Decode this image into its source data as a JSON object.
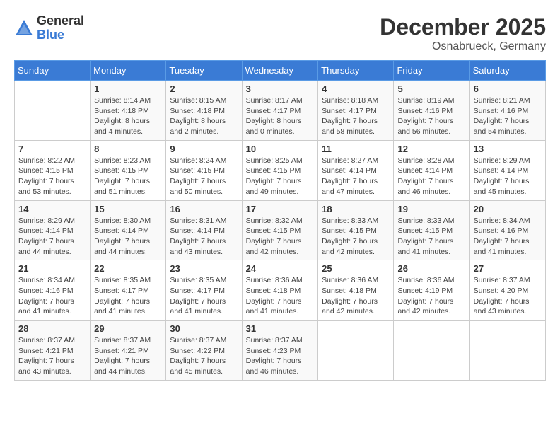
{
  "header": {
    "logo_general": "General",
    "logo_blue": "Blue",
    "month": "December 2025",
    "location": "Osnabrueck, Germany"
  },
  "days_of_week": [
    "Sunday",
    "Monday",
    "Tuesday",
    "Wednesday",
    "Thursday",
    "Friday",
    "Saturday"
  ],
  "weeks": [
    [
      {
        "day": "",
        "info": ""
      },
      {
        "day": "1",
        "info": "Sunrise: 8:14 AM\nSunset: 4:18 PM\nDaylight: 8 hours\nand 4 minutes."
      },
      {
        "day": "2",
        "info": "Sunrise: 8:15 AM\nSunset: 4:18 PM\nDaylight: 8 hours\nand 2 minutes."
      },
      {
        "day": "3",
        "info": "Sunrise: 8:17 AM\nSunset: 4:17 PM\nDaylight: 8 hours\nand 0 minutes."
      },
      {
        "day": "4",
        "info": "Sunrise: 8:18 AM\nSunset: 4:17 PM\nDaylight: 7 hours\nand 58 minutes."
      },
      {
        "day": "5",
        "info": "Sunrise: 8:19 AM\nSunset: 4:16 PM\nDaylight: 7 hours\nand 56 minutes."
      },
      {
        "day": "6",
        "info": "Sunrise: 8:21 AM\nSunset: 4:16 PM\nDaylight: 7 hours\nand 54 minutes."
      }
    ],
    [
      {
        "day": "7",
        "info": "Sunrise: 8:22 AM\nSunset: 4:15 PM\nDaylight: 7 hours\nand 53 minutes."
      },
      {
        "day": "8",
        "info": "Sunrise: 8:23 AM\nSunset: 4:15 PM\nDaylight: 7 hours\nand 51 minutes."
      },
      {
        "day": "9",
        "info": "Sunrise: 8:24 AM\nSunset: 4:15 PM\nDaylight: 7 hours\nand 50 minutes."
      },
      {
        "day": "10",
        "info": "Sunrise: 8:25 AM\nSunset: 4:15 PM\nDaylight: 7 hours\nand 49 minutes."
      },
      {
        "day": "11",
        "info": "Sunrise: 8:27 AM\nSunset: 4:14 PM\nDaylight: 7 hours\nand 47 minutes."
      },
      {
        "day": "12",
        "info": "Sunrise: 8:28 AM\nSunset: 4:14 PM\nDaylight: 7 hours\nand 46 minutes."
      },
      {
        "day": "13",
        "info": "Sunrise: 8:29 AM\nSunset: 4:14 PM\nDaylight: 7 hours\nand 45 minutes."
      }
    ],
    [
      {
        "day": "14",
        "info": "Sunrise: 8:29 AM\nSunset: 4:14 PM\nDaylight: 7 hours\nand 44 minutes."
      },
      {
        "day": "15",
        "info": "Sunrise: 8:30 AM\nSunset: 4:14 PM\nDaylight: 7 hours\nand 44 minutes."
      },
      {
        "day": "16",
        "info": "Sunrise: 8:31 AM\nSunset: 4:14 PM\nDaylight: 7 hours\nand 43 minutes."
      },
      {
        "day": "17",
        "info": "Sunrise: 8:32 AM\nSunset: 4:15 PM\nDaylight: 7 hours\nand 42 minutes."
      },
      {
        "day": "18",
        "info": "Sunrise: 8:33 AM\nSunset: 4:15 PM\nDaylight: 7 hours\nand 42 minutes."
      },
      {
        "day": "19",
        "info": "Sunrise: 8:33 AM\nSunset: 4:15 PM\nDaylight: 7 hours\nand 41 minutes."
      },
      {
        "day": "20",
        "info": "Sunrise: 8:34 AM\nSunset: 4:16 PM\nDaylight: 7 hours\nand 41 minutes."
      }
    ],
    [
      {
        "day": "21",
        "info": "Sunrise: 8:34 AM\nSunset: 4:16 PM\nDaylight: 7 hours\nand 41 minutes."
      },
      {
        "day": "22",
        "info": "Sunrise: 8:35 AM\nSunset: 4:17 PM\nDaylight: 7 hours\nand 41 minutes."
      },
      {
        "day": "23",
        "info": "Sunrise: 8:35 AM\nSunset: 4:17 PM\nDaylight: 7 hours\nand 41 minutes."
      },
      {
        "day": "24",
        "info": "Sunrise: 8:36 AM\nSunset: 4:18 PM\nDaylight: 7 hours\nand 41 minutes."
      },
      {
        "day": "25",
        "info": "Sunrise: 8:36 AM\nSunset: 4:18 PM\nDaylight: 7 hours\nand 42 minutes."
      },
      {
        "day": "26",
        "info": "Sunrise: 8:36 AM\nSunset: 4:19 PM\nDaylight: 7 hours\nand 42 minutes."
      },
      {
        "day": "27",
        "info": "Sunrise: 8:37 AM\nSunset: 4:20 PM\nDaylight: 7 hours\nand 43 minutes."
      }
    ],
    [
      {
        "day": "28",
        "info": "Sunrise: 8:37 AM\nSunset: 4:21 PM\nDaylight: 7 hours\nand 43 minutes."
      },
      {
        "day": "29",
        "info": "Sunrise: 8:37 AM\nSunset: 4:21 PM\nDaylight: 7 hours\nand 44 minutes."
      },
      {
        "day": "30",
        "info": "Sunrise: 8:37 AM\nSunset: 4:22 PM\nDaylight: 7 hours\nand 45 minutes."
      },
      {
        "day": "31",
        "info": "Sunrise: 8:37 AM\nSunset: 4:23 PM\nDaylight: 7 hours\nand 46 minutes."
      },
      {
        "day": "",
        "info": ""
      },
      {
        "day": "",
        "info": ""
      },
      {
        "day": "",
        "info": ""
      }
    ]
  ]
}
